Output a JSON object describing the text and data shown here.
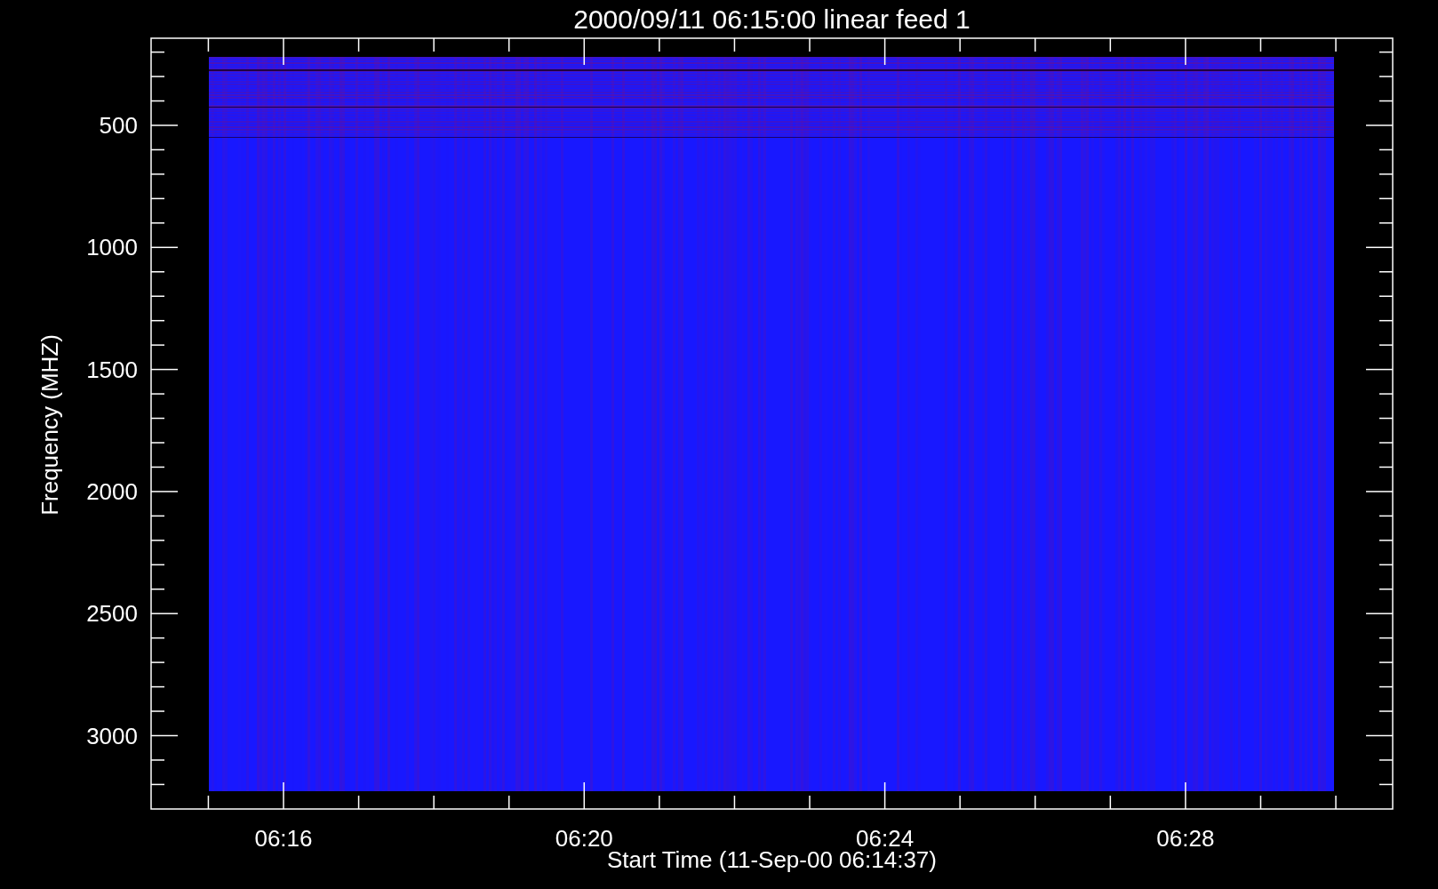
{
  "plot": {
    "title": "2000/09/11 06:15:00 linear feed 1",
    "y_axis": {
      "label": "Frequency (MHZ)",
      "ticks": [
        "500",
        "1000",
        "1500",
        "2000",
        "2500",
        "3000"
      ]
    },
    "x_axis": {
      "label": "Start Time (11-Sep-00 06:14:37)",
      "ticks": [
        "06:16",
        "06:20",
        "06:24",
        "06:28"
      ]
    }
  }
}
